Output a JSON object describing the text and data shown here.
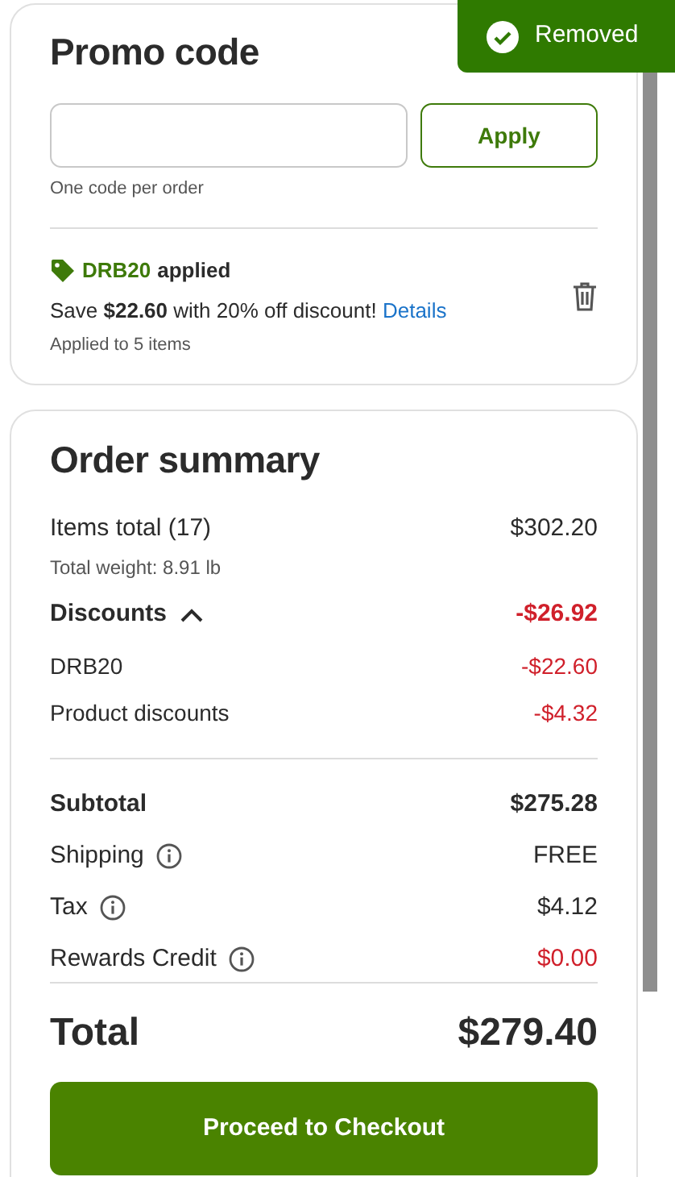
{
  "toast": {
    "text": "Removed"
  },
  "promo": {
    "title": "Promo code",
    "apply_button": "Apply",
    "hint": "One code per order",
    "applied": {
      "code": "DRB20",
      "status": "applied",
      "message": "Save **$22.60** with 20% off discount!",
      "link": "Details",
      "note": "Applied to 5 items"
    }
  },
  "summary": {
    "title": "Order summary",
    "rows": [
      {
        "kind": "line",
        "label": "Items total (17)",
        "value": "$302.20",
        "negative": false
      },
      {
        "kind": "note",
        "label": "Total weight: 8.91 lb"
      },
      {
        "kind": "toggle",
        "label": "Discounts",
        "value": "-$26.92",
        "negative": true,
        "expanded": true
      },
      {
        "kind": "sub",
        "label": "DRB20",
        "value": "-$22.60",
        "negative": true
      },
      {
        "kind": "sub",
        "label": "Product discounts",
        "value": "-$4.32",
        "negative": true
      },
      {
        "kind": "divider"
      },
      {
        "kind": "strong",
        "label": "Subtotal",
        "value": "$275.28",
        "negative": false
      },
      {
        "kind": "line",
        "label": "Shipping",
        "value": "FREE",
        "info": true,
        "negative": false
      },
      {
        "kind": "line",
        "label": "Tax",
        "value": "$4.12",
        "info": true,
        "negative": false
      },
      {
        "kind": "line",
        "label": "Rewards Credit",
        "value": "$0.00",
        "info": true,
        "negative": true
      },
      {
        "kind": "divider"
      },
      {
        "kind": "total",
        "label": "Total",
        "value": "$279.40",
        "negative": false
      }
    ],
    "checkout_button": "Proceed to Checkout"
  }
}
